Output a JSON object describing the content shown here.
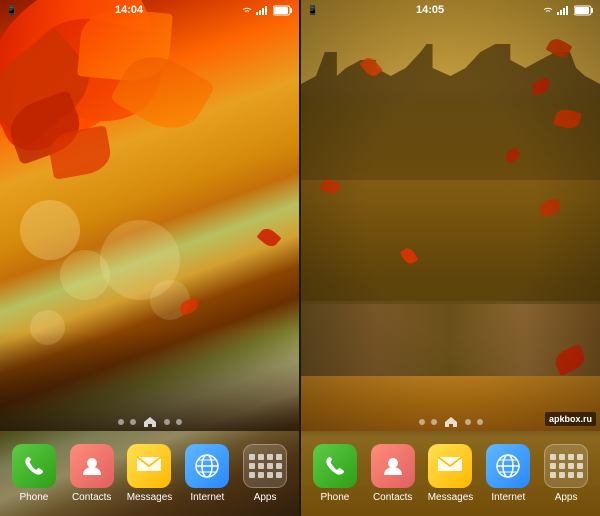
{
  "screens": {
    "left": {
      "status": {
        "icon_notification": "🔔",
        "time": "14:04",
        "signal": "▂▄▆",
        "wifi": "WiFi",
        "battery": "Battery"
      },
      "dots": [
        "dot",
        "dot",
        "dot-home",
        "dot",
        "dot"
      ],
      "dock": [
        {
          "id": "phone",
          "label": "Phone",
          "icon": "phone"
        },
        {
          "id": "contacts",
          "label": "Contacts",
          "icon": "person"
        },
        {
          "id": "messages",
          "label": "Messages",
          "icon": "envelope"
        },
        {
          "id": "internet",
          "label": "Internet",
          "icon": "globe"
        },
        {
          "id": "apps",
          "label": "Apps",
          "icon": "grid"
        }
      ]
    },
    "right": {
      "status": {
        "icon_notification": "🔔",
        "time": "14:05",
        "signal": "▂▄▆",
        "wifi": "WiFi",
        "battery": "Battery"
      },
      "dots": [
        "dot",
        "dot",
        "dot-home",
        "dot",
        "dot"
      ],
      "dock": [
        {
          "id": "phone",
          "label": "Phone",
          "icon": "phone"
        },
        {
          "id": "contacts",
          "label": "Contacts",
          "icon": "person"
        },
        {
          "id": "messages",
          "label": "Messages",
          "icon": "envelope"
        },
        {
          "id": "internet",
          "label": "Internet",
          "icon": "globe"
        },
        {
          "id": "apps",
          "label": "Apps",
          "icon": "grid"
        }
      ],
      "watermark": "apkbox.ru"
    }
  }
}
